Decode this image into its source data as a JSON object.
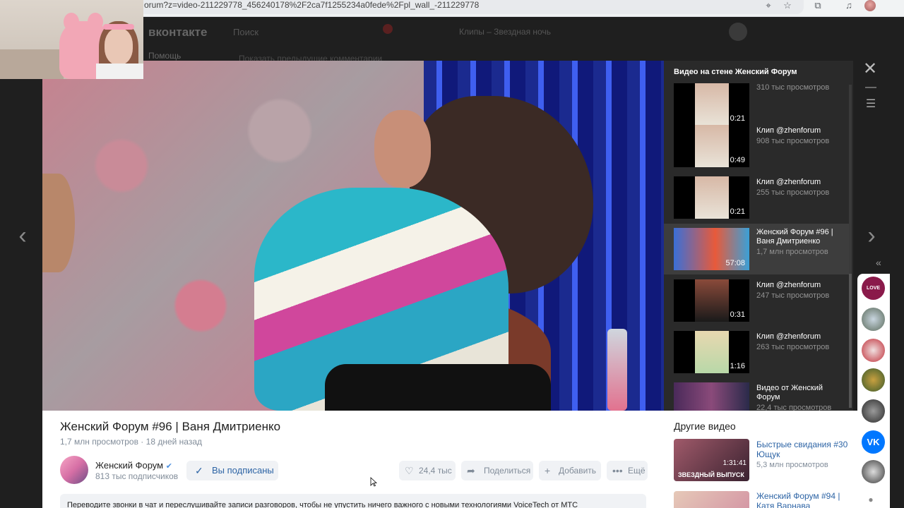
{
  "browser": {
    "url": "orum?z=video-211229778_456240178%2F2ca7f1255234a0fede%2Fpl_wall_-211229778",
    "icons": [
      "location-icon",
      "star-icon",
      "extensions-icon",
      "media-icon",
      "profile-avatar"
    ]
  },
  "vk": {
    "logo": "вконтакте",
    "search_placeholder": "Поиск",
    "now_playing": "Клипы – Звездная ночь",
    "left_menu_item": "Помощь",
    "middle_text": "Показать предыдущие комментарии"
  },
  "playlist": {
    "title": "Видео на стене Женский Форум",
    "items": [
      {
        "name": "",
        "views": "310 тыс просмотров",
        "duration": "0:21",
        "active": false
      },
      {
        "name": "Клип @zhenforum",
        "views": "908 тыс просмотров",
        "duration": "0:49",
        "active": false
      },
      {
        "name": "Клип @zhenforum",
        "views": "255 тыс просмотров",
        "duration": "0:21",
        "active": false
      },
      {
        "name": "Женский Форум #96 | Ваня Дмитриенко",
        "views": "1,7 млн просмотров",
        "duration": "57:08",
        "active": true
      },
      {
        "name": "Клип @zhenforum",
        "views": "247 тыс просмотров",
        "duration": "0:31",
        "active": false
      },
      {
        "name": "Клип @zhenforum",
        "views": "263 тыс просмотров",
        "duration": "1:16",
        "active": false
      },
      {
        "name": "Видео от Женский Форум",
        "views": "22,4 тыс просмотров",
        "duration": "",
        "active": false
      }
    ]
  },
  "video": {
    "title": "Женский Форум #96 | Ваня Дмитриенко",
    "views": "1,7 млн просмотров",
    "date": "18 дней назад"
  },
  "channel": {
    "name": "Женский Форум",
    "subscribers": "813 тыс подписчиков",
    "subscribe_label": "Вы подписаны"
  },
  "actions": {
    "likes": "24,4 тыс",
    "share": "Поделиться",
    "add": "Добавить",
    "more": "Ещё"
  },
  "promo": "Переводите звонки в чат и переслушивайте записи разговоров, чтобы не упустить ничего важного с новыми технологиями VoiceTech от МТС",
  "other": {
    "title": "Другие видео",
    "items": [
      {
        "name": "Быстрые свидания #30 Ющук",
        "views": "5,3 млн просмотров",
        "duration": "1:31:41",
        "tag": "ЗВЕЗДНЫЙ ВЫПУСК"
      },
      {
        "name": "Женский Форум #94 | Катя Варнава",
        "views": "",
        "duration": "",
        "tag": ""
      }
    ]
  },
  "sidebar_avatars": [
    "LOVE BOT",
    "",
    "",
    "",
    "",
    "VK",
    "",
    ""
  ],
  "colors": {
    "accent": "#2d64a5",
    "panel": "#2a2a2a",
    "active_item": "#3d3d3d"
  }
}
